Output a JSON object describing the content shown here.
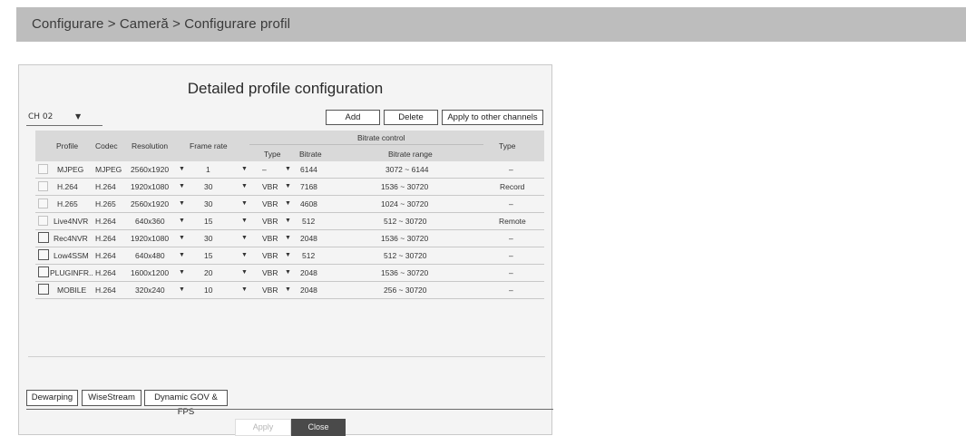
{
  "breadcrumb": "Configurare > Cameră > Configurare profil",
  "dialog": {
    "title": "Detailed profile configuration",
    "channel": "CH 02",
    "buttons": {
      "add": "Add",
      "delete": "Delete",
      "apply_other": "Apply to other channels"
    },
    "headers": {
      "profile": "Profile",
      "codec": "Codec",
      "resolution": "Resolution",
      "frame_rate": "Frame rate",
      "bitrate_control": "Bitrate control",
      "type": "Type",
      "bitrate": "Bitrate",
      "bitrate_range": "Bitrate range",
      "type_col": "Type"
    },
    "rows": [
      {
        "profile": "MJPEG",
        "codec": "MJPEG",
        "resolution": "2560x1920",
        "frame_rate": "1",
        "bc_type": "–",
        "bitrate": "6144",
        "range": "3072 ~ 6144",
        "type": "–"
      },
      {
        "profile": "H.264",
        "codec": "H.264",
        "resolution": "1920x1080",
        "frame_rate": "30",
        "bc_type": "VBR",
        "bitrate": "7168",
        "range": "1536 ~ 30720",
        "type": "Record"
      },
      {
        "profile": "H.265",
        "codec": "H.265",
        "resolution": "2560x1920",
        "frame_rate": "30",
        "bc_type": "VBR",
        "bitrate": "4608",
        "range": "1024 ~ 30720",
        "type": "–"
      },
      {
        "profile": "Live4NVR",
        "codec": "H.264",
        "resolution": "640x360",
        "frame_rate": "15",
        "bc_type": "VBR",
        "bitrate": "512",
        "range": "512 ~ 30720",
        "type": "Remote"
      },
      {
        "profile": "Rec4NVR",
        "codec": "H.264",
        "resolution": "1920x1080",
        "frame_rate": "30",
        "bc_type": "VBR",
        "bitrate": "2048",
        "range": "1536 ~ 30720",
        "type": "–"
      },
      {
        "profile": "Low4SSM",
        "codec": "H.264",
        "resolution": "640x480",
        "frame_rate": "15",
        "bc_type": "VBR",
        "bitrate": "512",
        "range": "512 ~ 30720",
        "type": "–"
      },
      {
        "profile": "PLUGINFR..",
        "codec": "H.264",
        "resolution": "1600x1200",
        "frame_rate": "20",
        "bc_type": "VBR",
        "bitrate": "2048",
        "range": "1536 ~ 30720",
        "type": "–"
      },
      {
        "profile": "MOBILE",
        "codec": "H.264",
        "resolution": "320x240",
        "frame_rate": "10",
        "bc_type": "VBR",
        "bitrate": "2048",
        "range": "256 ~ 30720",
        "type": "–"
      }
    ],
    "tabs": {
      "dewarping": "Dewarping",
      "wisestream": "WiseStream",
      "dynamic_gov": "Dynamic GOV & FPS"
    },
    "footer": {
      "apply": "Apply",
      "close": "Close"
    }
  }
}
